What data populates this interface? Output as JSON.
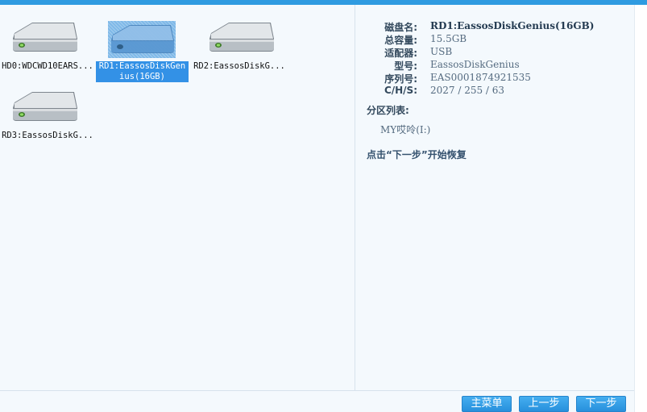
{
  "disks": [
    {
      "label": "HD0:WDCWD10EARS...",
      "selected": false
    },
    {
      "label": "RD1:EassosDiskGenius(16GB)",
      "selected": true
    },
    {
      "label": "RD2:EassosDiskG...",
      "selected": false
    },
    {
      "label": "RD3:EassosDiskG...",
      "selected": false
    }
  ],
  "disk_icon": "hard-drive-icon",
  "info": {
    "disk_name_label": "磁盘名:",
    "disk_name_value": "RD1:EassosDiskGenius(16GB)",
    "capacity_label": "总容量:",
    "capacity_value": "15.5GB",
    "adapter_label": "适配器:",
    "adapter_value": "USB",
    "model_label": "型号:",
    "model_value": "EassosDiskGenius",
    "serial_label": "序列号:",
    "serial_value": "EAS0001874921535",
    "chs_label": "C/H/S:",
    "chs_value": "2027 / 255 / 63"
  },
  "partitions": {
    "title": "分区列表:",
    "items": [
      "MY哎呤(I:)"
    ]
  },
  "hint": "点击“下一步”开始恢复",
  "buttons": {
    "main_menu": "主菜单",
    "prev": "上一步",
    "next": "下一步"
  },
  "colors": {
    "accent": "#2f9be1",
    "selection": "#3391e6",
    "background": "#f4f9fd"
  }
}
